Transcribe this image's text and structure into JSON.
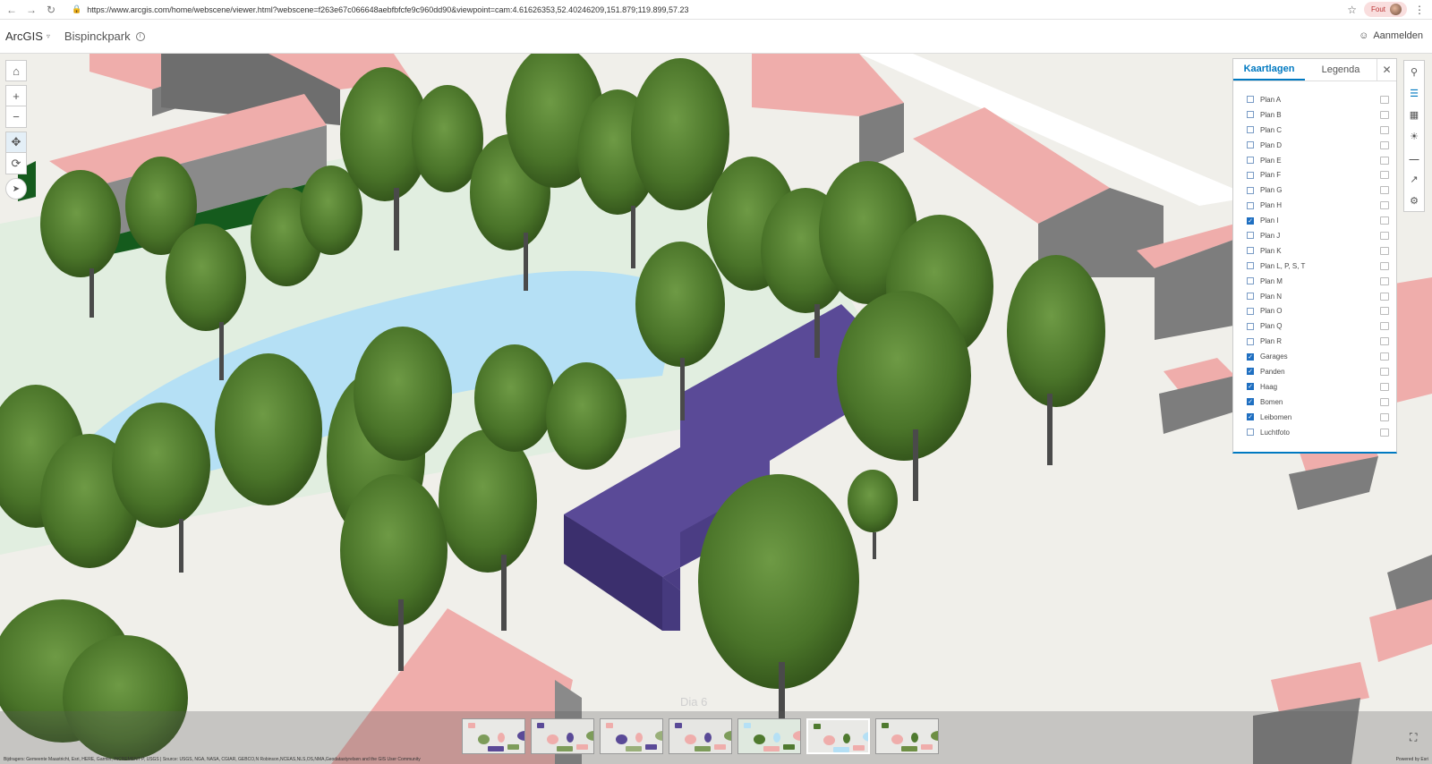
{
  "browser": {
    "url": "https://www.arcgis.com/home/webscene/viewer.html?webscene=f263e67c066648aebfbfcfe9c960dd90&viewpoint=cam:4.61626353,52.40246209,151.879;119.899,57.23",
    "profile_label": "Fout",
    "icons": [
      "back-icon",
      "forward-icon",
      "reload-icon",
      "lock-icon",
      "star-icon",
      "kebab-menu-icon"
    ]
  },
  "header": {
    "brand": "ArcGIS",
    "scene_title": "Bispinckpark",
    "signin_label": "Aanmelden"
  },
  "layer_panel": {
    "tabs": [
      {
        "label": "Kaartlagen",
        "active": true
      },
      {
        "label": "Legenda",
        "active": false
      }
    ],
    "layers": [
      {
        "name": "Plan A",
        "checked": false
      },
      {
        "name": "Plan B",
        "checked": false
      },
      {
        "name": "Plan C",
        "checked": false
      },
      {
        "name": "Plan D",
        "checked": false
      },
      {
        "name": "Plan E",
        "checked": false
      },
      {
        "name": "Plan F",
        "checked": false
      },
      {
        "name": "Plan G",
        "checked": false
      },
      {
        "name": "Plan H",
        "checked": false
      },
      {
        "name": "Plan I",
        "checked": true
      },
      {
        "name": "Plan J",
        "checked": false
      },
      {
        "name": "Plan K",
        "checked": false
      },
      {
        "name": "Plan L, P, S, T",
        "checked": false
      },
      {
        "name": "Plan M",
        "checked": false
      },
      {
        "name": "Plan N",
        "checked": false
      },
      {
        "name": "Plan O",
        "checked": false
      },
      {
        "name": "Plan Q",
        "checked": false
      },
      {
        "name": "Plan R",
        "checked": false
      },
      {
        "name": "Garages",
        "checked": true
      },
      {
        "name": "Panden",
        "checked": true
      },
      {
        "name": "Haag",
        "checked": true
      },
      {
        "name": "Bomen",
        "checked": true
      },
      {
        "name": "Leibomen",
        "checked": true
      },
      {
        "name": "Luchtfoto",
        "checked": false
      }
    ]
  },
  "slides": {
    "current_label": "Dia 6",
    "count": 7,
    "active_index": 5
  },
  "attribution": "Bijdragers: Gemeente Maastricht, Esri, HERE, Garmin, INCREMENT P, USGS | Source: USGS, NGA, NASA, CGIAR, GEBCO,N Robinson,NCEAS,NLS,OS,NMA,Geodatastyrelsen and the GIS User Community",
  "powered_by": "Powered by Esri",
  "colors": {
    "accent": "#0079c1",
    "plan_building": "#55468f",
    "water": "#b5e0f5",
    "roof": "#efadab",
    "tree": "#4f7a2f"
  }
}
